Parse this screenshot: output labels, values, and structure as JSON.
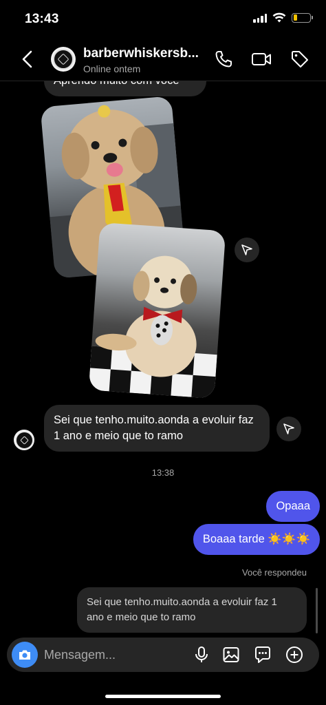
{
  "status_bar": {
    "time": "13:43",
    "battery_level": 0.2,
    "battery_color": "#f3c200"
  },
  "header": {
    "contact_name": "barberwhiskersb...",
    "contact_status": "Online ontem",
    "icons": [
      "chevron-left-icon",
      "phone-icon",
      "video-camera-icon",
      "tag-icon"
    ]
  },
  "chat": {
    "partial_message": "Aprendo muito com você",
    "photos": [
      {
        "subject": "dog-with-yellow-red-tie"
      },
      {
        "subject": "dog-with-red-bow-and-bandana"
      }
    ],
    "incoming_message": "Sei que tenho.muito.aonda a evoluir faz 1 ano e meio que to ramo",
    "timestamp": "13:38",
    "outgoing_messages": [
      {
        "text": "Opaaa"
      },
      {
        "text": "Boaaa tarde ☀️☀️☀️"
      }
    ],
    "replied_label": "Você respondeu",
    "reply_preview": "Sei que tenho.muito.aonda a evoluir faz 1 ano e meio que to ramo"
  },
  "composer": {
    "placeholder": "Mensagem...",
    "icons": [
      "camera-icon",
      "microphone-icon",
      "image-icon",
      "sticker-icon",
      "plus-icon"
    ]
  },
  "colors": {
    "accent": "#5055eb",
    "camera": "#3e8cf5",
    "bubble_in": "#262626"
  }
}
